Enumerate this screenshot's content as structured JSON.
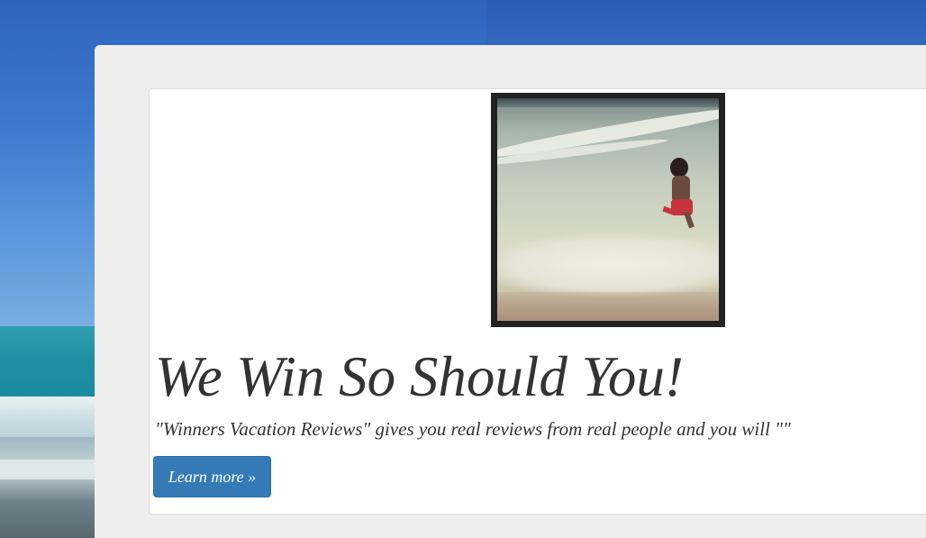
{
  "hero": {
    "title": "We Win So Should You!",
    "description": "\"Winners Vacation Reviews\" gives you real reviews from real people and you will \"\"",
    "button_label": "Learn more »"
  },
  "colors": {
    "button_bg": "#337ab7",
    "panel_bg": "#eeeeee",
    "card_bg": "#ffffff",
    "text": "#333333"
  }
}
